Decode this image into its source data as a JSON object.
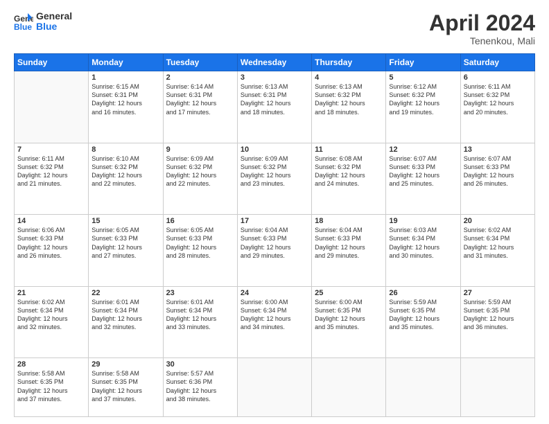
{
  "header": {
    "logo_line1": "General",
    "logo_line2": "Blue",
    "month": "April 2024",
    "location": "Tenenkou, Mali"
  },
  "weekdays": [
    "Sunday",
    "Monday",
    "Tuesday",
    "Wednesday",
    "Thursday",
    "Friday",
    "Saturday"
  ],
  "weeks": [
    [
      {
        "day": "",
        "info": ""
      },
      {
        "day": "1",
        "info": "Sunrise: 6:15 AM\nSunset: 6:31 PM\nDaylight: 12 hours\nand 16 minutes."
      },
      {
        "day": "2",
        "info": "Sunrise: 6:14 AM\nSunset: 6:31 PM\nDaylight: 12 hours\nand 17 minutes."
      },
      {
        "day": "3",
        "info": "Sunrise: 6:13 AM\nSunset: 6:31 PM\nDaylight: 12 hours\nand 18 minutes."
      },
      {
        "day": "4",
        "info": "Sunrise: 6:13 AM\nSunset: 6:32 PM\nDaylight: 12 hours\nand 18 minutes."
      },
      {
        "day": "5",
        "info": "Sunrise: 6:12 AM\nSunset: 6:32 PM\nDaylight: 12 hours\nand 19 minutes."
      },
      {
        "day": "6",
        "info": "Sunrise: 6:11 AM\nSunset: 6:32 PM\nDaylight: 12 hours\nand 20 minutes."
      }
    ],
    [
      {
        "day": "7",
        "info": "Sunrise: 6:11 AM\nSunset: 6:32 PM\nDaylight: 12 hours\nand 21 minutes."
      },
      {
        "day": "8",
        "info": "Sunrise: 6:10 AM\nSunset: 6:32 PM\nDaylight: 12 hours\nand 22 minutes."
      },
      {
        "day": "9",
        "info": "Sunrise: 6:09 AM\nSunset: 6:32 PM\nDaylight: 12 hours\nand 22 minutes."
      },
      {
        "day": "10",
        "info": "Sunrise: 6:09 AM\nSunset: 6:32 PM\nDaylight: 12 hours\nand 23 minutes."
      },
      {
        "day": "11",
        "info": "Sunrise: 6:08 AM\nSunset: 6:32 PM\nDaylight: 12 hours\nand 24 minutes."
      },
      {
        "day": "12",
        "info": "Sunrise: 6:07 AM\nSunset: 6:33 PM\nDaylight: 12 hours\nand 25 minutes."
      },
      {
        "day": "13",
        "info": "Sunrise: 6:07 AM\nSunset: 6:33 PM\nDaylight: 12 hours\nand 26 minutes."
      }
    ],
    [
      {
        "day": "14",
        "info": "Sunrise: 6:06 AM\nSunset: 6:33 PM\nDaylight: 12 hours\nand 26 minutes."
      },
      {
        "day": "15",
        "info": "Sunrise: 6:05 AM\nSunset: 6:33 PM\nDaylight: 12 hours\nand 27 minutes."
      },
      {
        "day": "16",
        "info": "Sunrise: 6:05 AM\nSunset: 6:33 PM\nDaylight: 12 hours\nand 28 minutes."
      },
      {
        "day": "17",
        "info": "Sunrise: 6:04 AM\nSunset: 6:33 PM\nDaylight: 12 hours\nand 29 minutes."
      },
      {
        "day": "18",
        "info": "Sunrise: 6:04 AM\nSunset: 6:33 PM\nDaylight: 12 hours\nand 29 minutes."
      },
      {
        "day": "19",
        "info": "Sunrise: 6:03 AM\nSunset: 6:34 PM\nDaylight: 12 hours\nand 30 minutes."
      },
      {
        "day": "20",
        "info": "Sunrise: 6:02 AM\nSunset: 6:34 PM\nDaylight: 12 hours\nand 31 minutes."
      }
    ],
    [
      {
        "day": "21",
        "info": "Sunrise: 6:02 AM\nSunset: 6:34 PM\nDaylight: 12 hours\nand 32 minutes."
      },
      {
        "day": "22",
        "info": "Sunrise: 6:01 AM\nSunset: 6:34 PM\nDaylight: 12 hours\nand 32 minutes."
      },
      {
        "day": "23",
        "info": "Sunrise: 6:01 AM\nSunset: 6:34 PM\nDaylight: 12 hours\nand 33 minutes."
      },
      {
        "day": "24",
        "info": "Sunrise: 6:00 AM\nSunset: 6:34 PM\nDaylight: 12 hours\nand 34 minutes."
      },
      {
        "day": "25",
        "info": "Sunrise: 6:00 AM\nSunset: 6:35 PM\nDaylight: 12 hours\nand 35 minutes."
      },
      {
        "day": "26",
        "info": "Sunrise: 5:59 AM\nSunset: 6:35 PM\nDaylight: 12 hours\nand 35 minutes."
      },
      {
        "day": "27",
        "info": "Sunrise: 5:59 AM\nSunset: 6:35 PM\nDaylight: 12 hours\nand 36 minutes."
      }
    ],
    [
      {
        "day": "28",
        "info": "Sunrise: 5:58 AM\nSunset: 6:35 PM\nDaylight: 12 hours\nand 37 minutes."
      },
      {
        "day": "29",
        "info": "Sunrise: 5:58 AM\nSunset: 6:35 PM\nDaylight: 12 hours\nand 37 minutes."
      },
      {
        "day": "30",
        "info": "Sunrise: 5:57 AM\nSunset: 6:36 PM\nDaylight: 12 hours\nand 38 minutes."
      },
      {
        "day": "",
        "info": ""
      },
      {
        "day": "",
        "info": ""
      },
      {
        "day": "",
        "info": ""
      },
      {
        "day": "",
        "info": ""
      }
    ]
  ]
}
